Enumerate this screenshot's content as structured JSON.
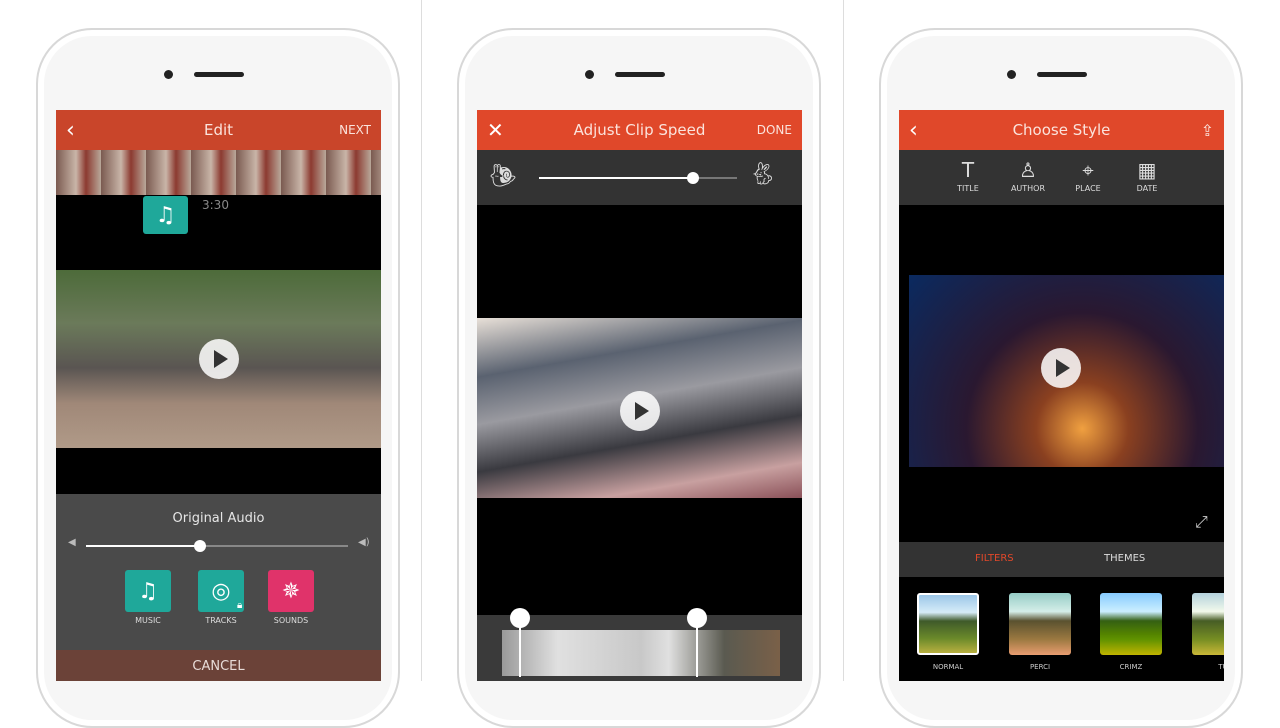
{
  "screens": [
    {
      "header": {
        "back_icon": "chevron-left",
        "title": "Edit",
        "action": "NEXT"
      },
      "timeline": {
        "time": "3:30"
      },
      "audio": {
        "title": "Original Audio",
        "volume_percent": 40
      },
      "options": [
        {
          "label": "MUSIC",
          "icon": "music-note",
          "color": "#1fa89a"
        },
        {
          "label": "TRACKS",
          "icon": "music-circle",
          "color": "#1fa89a",
          "locked": true
        },
        {
          "label": "SOUNDS",
          "icon": "starburst",
          "color": "#e0336a"
        }
      ],
      "cancel": "CANCEL"
    },
    {
      "header": {
        "close_icon": "x",
        "title": "Adjust Clip Speed",
        "action": "DONE"
      },
      "speed": {
        "slow_icon": "snail",
        "fast_icon": "rabbit",
        "value_percent": 78
      }
    },
    {
      "header": {
        "back_icon": "chevron-left",
        "title": "Choose Style",
        "share_icon": "share"
      },
      "tools": [
        {
          "label": "TITLE",
          "icon": "T"
        },
        {
          "label": "AUTHOR",
          "icon": "person"
        },
        {
          "label": "PLACE",
          "icon": "map-pin"
        },
        {
          "label": "DATE",
          "icon": "calendar"
        }
      ],
      "tabs": [
        {
          "label": "FILTERS",
          "active": true
        },
        {
          "label": "THEMES",
          "active": false
        }
      ],
      "filters": [
        "NORMAL",
        "PERCI",
        "CRIMZ",
        "TU"
      ]
    }
  ],
  "colors": {
    "accent": "#e0482a",
    "teal": "#1fa89a",
    "pink": "#e0336a"
  }
}
